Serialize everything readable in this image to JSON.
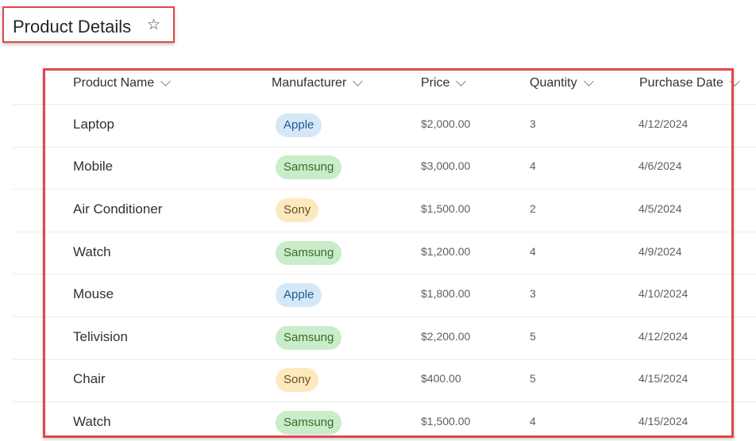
{
  "header": {
    "title": "Product Details",
    "favorite_icon": "star-outline-icon"
  },
  "table": {
    "columns": [
      {
        "label": "Product Name",
        "icon": "chevron-down-icon"
      },
      {
        "label": "Manufacturer",
        "icon": "chevron-down-icon"
      },
      {
        "label": "Price",
        "icon": "chevron-down-icon"
      },
      {
        "label": "Quantity",
        "icon": "chevron-down-icon"
      },
      {
        "label": "Purchase Date",
        "icon": "chevron-down-icon"
      }
    ],
    "rows": [
      {
        "name": "Laptop",
        "manufacturer": "Apple",
        "price": "$2,000.00",
        "quantity": "3",
        "date": "4/12/2024"
      },
      {
        "name": "Mobile",
        "manufacturer": "Samsung",
        "price": "$3,000.00",
        "quantity": "4",
        "date": "4/6/2024"
      },
      {
        "name": "Air Conditioner",
        "manufacturer": "Sony",
        "price": "$1,500.00",
        "quantity": "2",
        "date": "4/5/2024"
      },
      {
        "name": "Watch",
        "manufacturer": "Samsung",
        "price": "$1,200.00",
        "quantity": "4",
        "date": "4/9/2024"
      },
      {
        "name": "Mouse",
        "manufacturer": "Apple",
        "price": "$1,800.00",
        "quantity": "3",
        "date": "4/10/2024"
      },
      {
        "name": "Telivision",
        "manufacturer": "Samsung",
        "price": "$2,200.00",
        "quantity": "5",
        "date": "4/12/2024"
      },
      {
        "name": "Chair",
        "manufacturer": "Sony",
        "price": "$400.00",
        "quantity": "5",
        "date": "4/15/2024"
      },
      {
        "name": "Watch",
        "manufacturer": "Samsung",
        "price": "$1,500.00",
        "quantity": "4",
        "date": "4/15/2024"
      }
    ]
  },
  "manufacturer_colors": {
    "Apple": {
      "bg": "#d6e8f7",
      "fg": "#1f5a94"
    },
    "Samsung": {
      "bg": "#c9ecc9",
      "fg": "#3a6b2a"
    },
    "Sony": {
      "bg": "#fde9bf",
      "fg": "#6b4e1a"
    }
  },
  "highlight_color": "#e0474c"
}
